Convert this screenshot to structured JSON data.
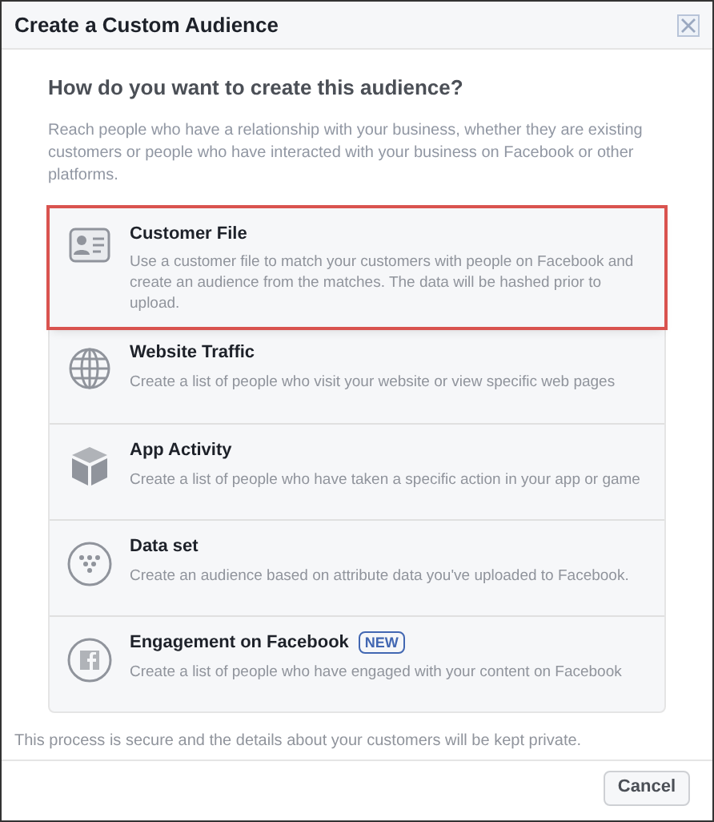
{
  "window": {
    "title": "Create a Custom Audience"
  },
  "heading": "How do you want to create this audience?",
  "intro": "Reach people who have a relationship with your business, whether they are existing customers or people who have interacted with your business on Facebook or other platforms.",
  "options": [
    {
      "kind": "file",
      "title": "Customer File",
      "description": "Use a customer file to match your customers with people on Facebook and create an audience from the matches. The data will be hashed prior to upload.",
      "highlighted": true
    },
    {
      "kind": "website",
      "title": "Website Traffic",
      "description": "Create a list of people who visit your website or view specific web pages",
      "highlighted": false
    },
    {
      "kind": "app",
      "title": "App Activity",
      "description": "Create a list of people who have taken a specific action in your app or game",
      "highlighted": false
    },
    {
      "kind": "dataset",
      "title": "Data set",
      "description": "Create an audience based on attribute data you've uploaded to Facebook.",
      "highlighted": false
    },
    {
      "kind": "engagement",
      "title": "Engagement on Facebook",
      "badge": "NEW",
      "description": "Create a list of people who have engaged with your content on Facebook",
      "highlighted": false
    }
  ],
  "footnote": "This process is secure and the details about your customers will be kept private.",
  "buttons": [
    "Cancel"
  ]
}
